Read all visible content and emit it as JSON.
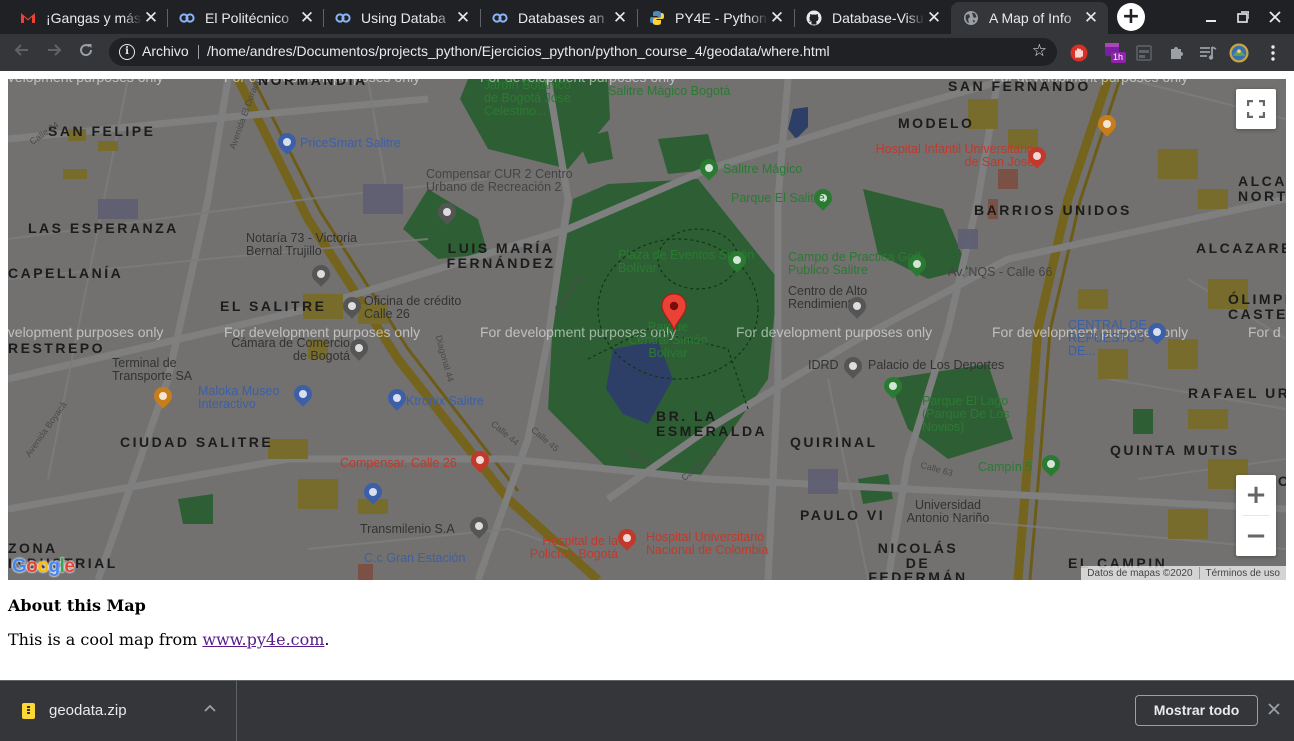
{
  "browser": {
    "tabs": [
      {
        "title": "¡Gangas y más",
        "icon": "gmail-icon"
      },
      {
        "title": "El Politécnico",
        "icon": "coursera-icon"
      },
      {
        "title": "Using Databa",
        "icon": "coursera-icon"
      },
      {
        "title": "Databases an",
        "icon": "coursera-icon"
      },
      {
        "title": "PY4E - Python",
        "icon": "python-icon"
      },
      {
        "title": "Database-Visu",
        "icon": "github-icon"
      },
      {
        "title": "A Map of Info",
        "icon": "globe-icon",
        "active": true
      }
    ],
    "tab_close": "✕",
    "new_tab": "+",
    "address": {
      "security_label": "Archivo",
      "url": "/home/andres/Documentos/projects_python/Ejercicios_python/python_course_4/geodata/where.html"
    },
    "extensions": {
      "timer_badge": "1h"
    }
  },
  "map": {
    "watermark": "For development purposes only",
    "watermark_fragment_left": "evelopment purposes only",
    "watermark_fragment_right": "For d",
    "districts": [
      "NORMANDÍA",
      "SAN FELIPE",
      "MODELO",
      "SAN FERNANDO",
      "BARRIOS UNIDOS",
      "ALCAZ NORT",
      "LAS ESPERANZA",
      "LUIS MARÍA FERNÁNDEZ",
      "CAPELLANÍA",
      "EL SALITRE",
      "RESTREPO",
      "ÓLIMPI CASTEL",
      "RAFAEL UR",
      "CIUDAD SALITRE",
      "BR. LA ESMERALDA",
      "QUIRINAL",
      "QUINTA MUTIS",
      "BACO",
      "PAULO VI",
      "NICOLÁS DE FEDERMÁN",
      "EL CAMPIN",
      "ZONA INDUSTRIAL",
      "ALCAZARES"
    ],
    "places": [
      "Jardín Botánico de Bogotá José Celestino...",
      "Salitre Mágico Bogotá",
      "PriceSmart Salitre",
      "Compensar CUR 2 Centro Urbano de Recreación 2",
      "Salitre Mágico",
      "Parque El Salitre",
      "Hospital Infantil Universitario de San José",
      "Notaría 73 - Victoria Bernal Trujillo",
      "Plaza de Eventos Simón Bolívar",
      "Campo de Practica Golf Publico Salitre",
      "Av. NQS - Calle 66",
      "Oficina de crédito Calle 26",
      "Cámara de Comercio de Bogotá",
      "Centro de Alto Rendimiento",
      "Parque Central Simón Bolívar",
      "CENTRAL DE REPUESTOS - DE...",
      "Terminal de Transporte SA",
      "Maloka Museo Interactivo",
      "Ktronix Salitre",
      "IDRD",
      "Palacio de Los Deportes",
      "Parque El Lago (Parque De Los Novios)",
      "Compensar, Calle 26",
      "Campín 5",
      "Universidad Antonio Nariño",
      "Transmilenio S.A",
      "Hospital Universitario Nacional de Colombia",
      "Hospital de la Policía - Bogotá",
      "C.c Gran Estación"
    ],
    "streets": [
      "Avenida Boyacá",
      "Avenida El Dorado",
      "Calle 24",
      "Carrera 68",
      "Calle 53",
      "Carrera 60",
      "Calle 63",
      "Calle 45",
      "Calle 44",
      "Diagonal 44"
    ],
    "attribution": "Datos de mapas ©2020",
    "terms": "Términos de uso",
    "logo": "Google",
    "zoom_in": "+",
    "zoom_out": "−"
  },
  "content": {
    "heading": "About this Map",
    "text_before": "This is a cool map from ",
    "link": "www.py4e.com",
    "text_after": "."
  },
  "downloads": {
    "file": "geodata.zip",
    "show_all": "Mostrar todo"
  },
  "colors": {
    "tabstrip": "#202124",
    "toolbar": "#35363a",
    "marker": "#ea4335",
    "park": "#2f8a39",
    "water": "#3c5a9a",
    "highway": "#c9b84a"
  }
}
